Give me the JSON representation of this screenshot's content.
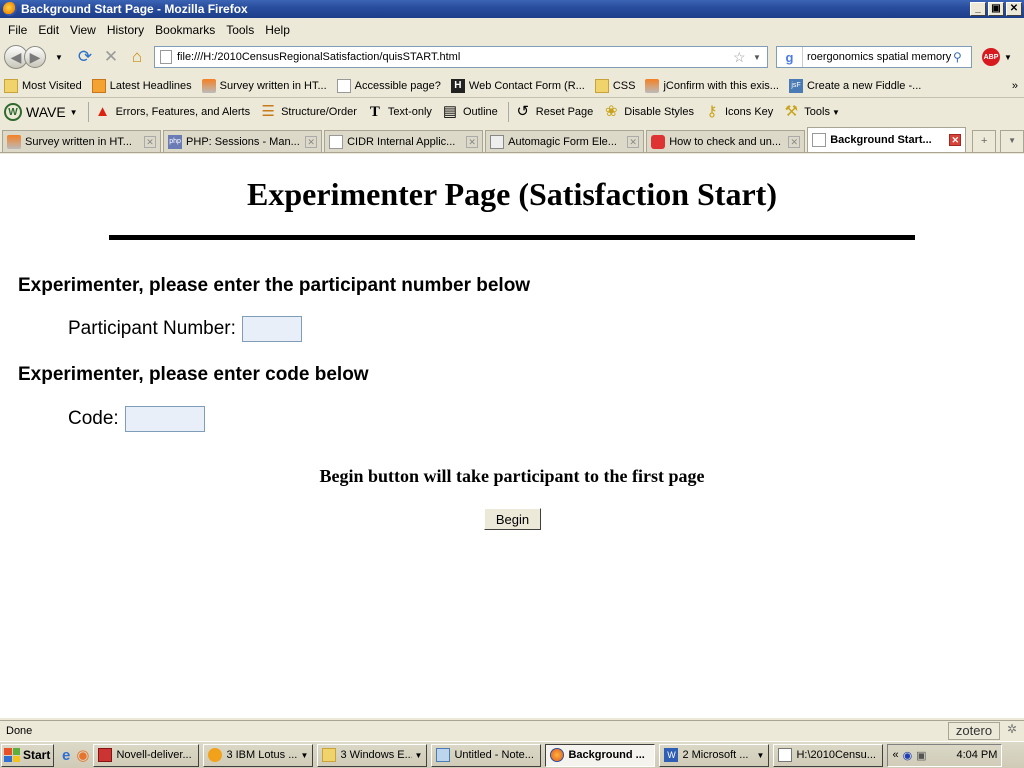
{
  "window": {
    "title": "Background Start Page - Mozilla Firefox",
    "controls": [
      "_",
      "▣",
      "✕"
    ]
  },
  "menu": [
    "File",
    "Edit",
    "View",
    "History",
    "Bookmarks",
    "Tools",
    "Help"
  ],
  "nav": {
    "url": "file:///H:/2010CensusRegionalSatisfaction/quisSTART.html",
    "search_value": "roergonomics spatial memory",
    "adblock_label": "ABP"
  },
  "bookmarks": [
    {
      "label": "Most Visited",
      "icon": "folder"
    },
    {
      "label": "Latest Headlines",
      "icon": "rss"
    },
    {
      "label": "Survey written in HT...",
      "icon": "so"
    },
    {
      "label": "Accessible page?",
      "icon": "page"
    },
    {
      "label": "Web Contact Form (R...",
      "icon": "h"
    },
    {
      "label": "CSS",
      "icon": "folder"
    },
    {
      "label": "jConfirm with this exis...",
      "icon": "so"
    },
    {
      "label": "Create a new Fiddle -...",
      "icon": "jsf"
    }
  ],
  "wave": {
    "logo": "WAVE",
    "items": [
      {
        "label": "Errors, Features, and Alerts",
        "icon": "errors-icon"
      },
      {
        "label": "Structure/Order",
        "icon": "structure-icon"
      },
      {
        "label": "Text-only",
        "icon": "text-icon"
      },
      {
        "label": "Outline",
        "icon": "outline-icon"
      },
      {
        "label": "Reset Page",
        "icon": "reset-icon"
      },
      {
        "label": "Disable Styles",
        "icon": "styles-icon"
      },
      {
        "label": "Icons Key",
        "icon": "key-icon"
      },
      {
        "label": "Tools",
        "icon": "tools-icon"
      }
    ]
  },
  "tabs": [
    {
      "label": "Survey written in HT...",
      "active": false
    },
    {
      "label": "PHP: Sessions - Man...",
      "active": false
    },
    {
      "label": "CIDR Internal Applic...",
      "active": false
    },
    {
      "label": "Automagic Form Ele...",
      "active": false
    },
    {
      "label": "How to check and un...",
      "active": false
    },
    {
      "label": "Background Start...",
      "active": true
    }
  ],
  "page": {
    "heading": "Experimenter Page (Satisfaction Start)",
    "participant_prompt": "Experimenter, please enter the participant number below",
    "participant_label": "Participant Number:",
    "participant_value": "",
    "code_prompt": "Experimenter, please enter code below",
    "code_label": "Code:",
    "code_value": "",
    "begin_note": "Begin button will take participant to the first page",
    "begin_label": "Begin"
  },
  "status": {
    "text": "Done",
    "zotero": "zotero"
  },
  "taskbar": {
    "start": "Start",
    "tasks": [
      {
        "label": "Novell-deliver...",
        "active": false
      },
      {
        "label": "3 IBM Lotus ...",
        "active": false
      },
      {
        "label": "3 Windows E...",
        "active": false
      },
      {
        "label": "Untitled - Note...",
        "active": false
      },
      {
        "label": "Background ...",
        "active": true
      },
      {
        "label": "2 Microsoft ...",
        "active": false
      },
      {
        "label": "H:\\2010Censu...",
        "active": false
      }
    ],
    "clock": "4:04 PM"
  },
  "colors": {
    "titlebar": "#2a4e9e",
    "input_bg": "#e8eff8",
    "input_border": "#7f9db9"
  }
}
